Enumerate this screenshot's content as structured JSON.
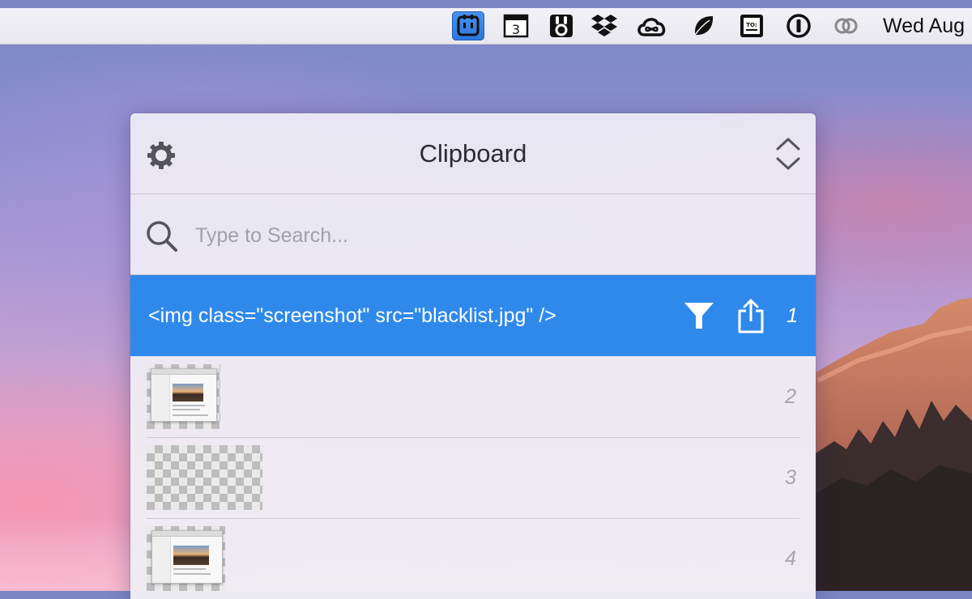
{
  "menubar": {
    "icons": [
      {
        "name": "clipboard-app-icon",
        "active": true
      },
      {
        "name": "calendar-icon",
        "label": "3"
      },
      {
        "name": "bartender-icon"
      },
      {
        "name": "dropbox-icon"
      },
      {
        "name": "creative-cloud-icon"
      },
      {
        "name": "leaf-icon"
      },
      {
        "name": "todo-icon",
        "label": "TO:"
      },
      {
        "name": "1password-icon"
      },
      {
        "name": "link-icon"
      }
    ],
    "clock": "Wed Aug"
  },
  "panel": {
    "title": "Clipboard",
    "search_placeholder": "Type to Search...",
    "search_value": ""
  },
  "items": [
    {
      "index": "1",
      "type": "text",
      "text": "<img class=\"screenshot\" src=\"blacklist.jpg\" />",
      "selected": true
    },
    {
      "index": "2",
      "type": "image"
    },
    {
      "index": "3",
      "type": "image"
    },
    {
      "index": "4",
      "type": "image"
    }
  ],
  "colors": {
    "selection": "#2f89eb",
    "menubar": "#ececf2",
    "active_menu_item": "#2c75dc"
  }
}
